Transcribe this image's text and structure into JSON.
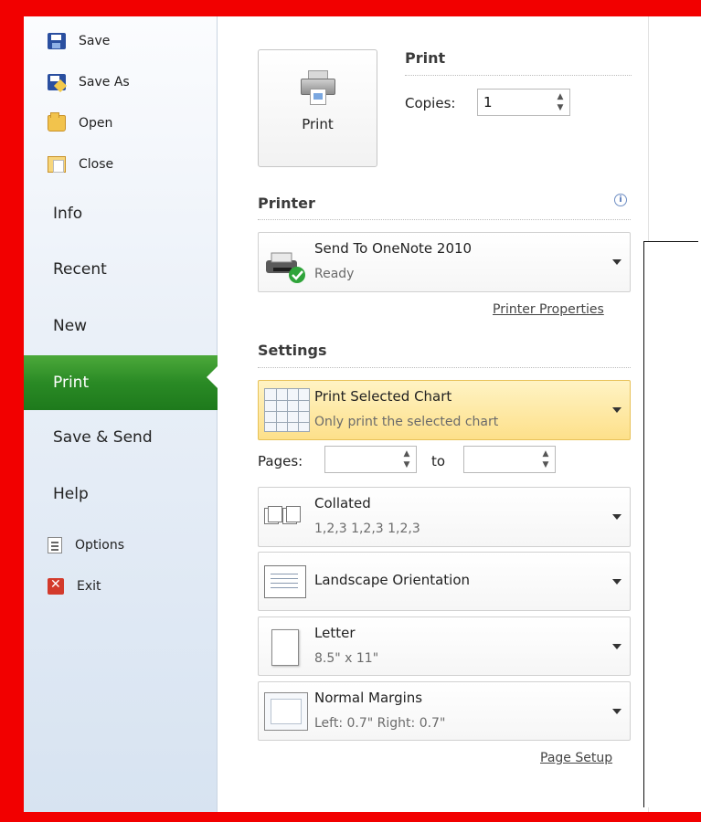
{
  "sidebar": {
    "save": "Save",
    "save_as": "Save As",
    "open": "Open",
    "close": "Close",
    "info": "Info",
    "recent": "Recent",
    "new": "New",
    "print": "Print",
    "save_send": "Save & Send",
    "help": "Help",
    "options": "Options",
    "exit": "Exit"
  },
  "print_section": {
    "title": "Print",
    "button_label": "Print",
    "copies_label": "Copies:",
    "copies_value": "1"
  },
  "printer": {
    "title": "Printer",
    "name": "Send To OneNote 2010",
    "status": "Ready",
    "properties_link": "Printer Properties"
  },
  "settings": {
    "title": "Settings",
    "what": {
      "title": "Print Selected Chart",
      "subtitle": "Only print the selected chart"
    },
    "pages_label": "Pages:",
    "pages_from": "",
    "to_label": "to",
    "pages_to": "",
    "collation": {
      "title": "Collated",
      "subtitle": "1,2,3    1,2,3    1,2,3"
    },
    "orientation": {
      "title": "Landscape Orientation"
    },
    "paper": {
      "title": "Letter",
      "subtitle": "8.5\" x 11\""
    },
    "margins": {
      "title": "Normal Margins",
      "subtitle": "Left:  0.7\"    Right:  0.7\""
    },
    "page_setup_link": "Page Setup"
  }
}
